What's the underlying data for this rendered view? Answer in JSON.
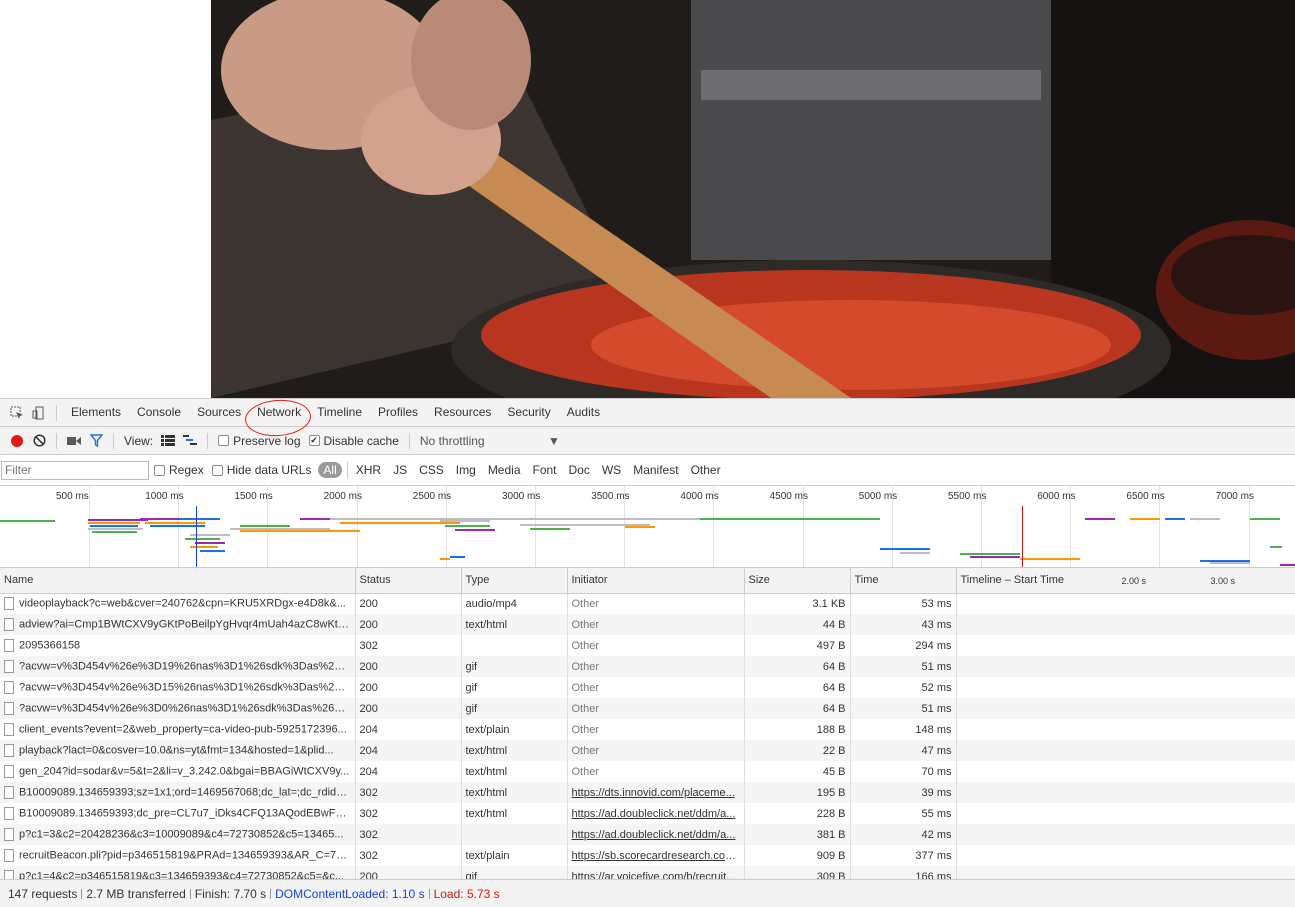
{
  "devtools_tabs": [
    "Elements",
    "Console",
    "Sources",
    "Network",
    "Timeline",
    "Profiles",
    "Resources",
    "Security",
    "Audits"
  ],
  "net_toolbar": {
    "view_label": "View:",
    "preserve_log": "Preserve log",
    "disable_cache": "Disable cache",
    "throttling": "No throttling"
  },
  "filter": {
    "placeholder": "Filter",
    "regex": "Regex",
    "hide_data_urls": "Hide data URLs",
    "types": [
      "All",
      "XHR",
      "JS",
      "CSS",
      "Img",
      "Media",
      "Font",
      "Doc",
      "WS",
      "Manifest",
      "Other"
    ]
  },
  "overview_ticks": [
    "500 ms",
    "1000 ms",
    "1500 ms",
    "2000 ms",
    "2500 ms",
    "3000 ms",
    "3500 ms",
    "4000 ms",
    "4500 ms",
    "5000 ms",
    "5500 ms",
    "6000 ms",
    "6500 ms",
    "7000 ms"
  ],
  "table": {
    "columns": [
      "Name",
      "Status",
      "Type",
      "Initiator",
      "Size",
      "Time",
      "Timeline – Start Time"
    ],
    "timeline_marks": [
      "2.00 s",
      "3.00 s"
    ],
    "rows": [
      {
        "name": "videoplayback?c=web&cver=240762&cpn=KRU5XRDgx-e4D8k&...",
        "status": "200",
        "type": "audio/mp4",
        "initiator": "Other",
        "size": "3.1 KB",
        "time": "53 ms"
      },
      {
        "name": "adview?ai=Cmp1BWtCXV9yGKtPoBeilpYgHvqr4mUah4azC8wKtAh...",
        "status": "200",
        "type": "text/html",
        "initiator": "Other",
        "size": "44 B",
        "time": "43 ms"
      },
      {
        "name": "2095366158",
        "status": "302",
        "type": "",
        "initiator": "Other",
        "size": "497 B",
        "time": "294 ms"
      },
      {
        "name": "?acvw=v%3D454v%26e%3D19%26nas%3D1%26sdk%3Das%26p%...",
        "status": "200",
        "type": "gif",
        "initiator": "Other",
        "size": "64 B",
        "time": "51 ms"
      },
      {
        "name": "?acvw=v%3D454v%26e%3D15%26nas%3D1%26sdk%3Das%26p%...",
        "status": "200",
        "type": "gif",
        "initiator": "Other",
        "size": "64 B",
        "time": "52 ms"
      },
      {
        "name": "?acvw=v%3D454v%26e%3D0%26nas%3D1%26sdk%3Das%26p%3...",
        "status": "200",
        "type": "gif",
        "initiator": "Other",
        "size": "64 B",
        "time": "51 ms"
      },
      {
        "name": "client_events?event=2&web_property=ca-video-pub-5925172396...",
        "status": "204",
        "type": "text/plain",
        "initiator": "Other",
        "size": "188 B",
        "time": "148 ms"
      },
      {
        "name": "playback?lact=0&cosver=10.0&ns=yt&fmt=134&hosted=1&plid...",
        "status": "204",
        "type": "text/html",
        "initiator": "Other",
        "size": "22 B",
        "time": "47 ms"
      },
      {
        "name": "gen_204?id=sodar&v=5&t=2&li=v_3.242.0&bgai=BBAGiWtCXV9y...",
        "status": "204",
        "type": "text/html",
        "initiator": "Other",
        "size": "45 B",
        "time": "70 ms"
      },
      {
        "name": "B10009089.134659393;sz=1x1;ord=1469567068;dc_lat=;dc_rdid=;...",
        "status": "302",
        "type": "text/html",
        "initiator": "https://dts.innovid.com/placeme...",
        "size": "195 B",
        "time": "39 ms"
      },
      {
        "name": "B10009089.134659393;dc_pre=CL7u7_iDks4CFQ13AQodEBwFzA;s...",
        "status": "302",
        "type": "text/html",
        "initiator": "https://ad.doubleclick.net/ddm/a...",
        "size": "228 B",
        "time": "55 ms"
      },
      {
        "name": "p?c1=3&c2=20428236&c3=10009089&c4=72730852&c5=13465...",
        "status": "302",
        "type": "",
        "initiator": "https://ad.doubleclick.net/ddm/a...",
        "size": "381 B",
        "time": "42 ms"
      },
      {
        "name": "recruitBeacon.pli?pid=p346515819&PRAd=134659393&AR_C=72...",
        "status": "302",
        "type": "text/plain",
        "initiator": "https://sb.scorecardresearch.com...",
        "size": "909 B",
        "time": "377 ms"
      },
      {
        "name": "p?c1=4&c2=p346515819&c3=134659393&c4=72730852&c5=&c...",
        "status": "200",
        "type": "gif",
        "initiator": "https://ar.voicefive.com/b/recruit...",
        "size": "309 B",
        "time": "166 ms"
      }
    ]
  },
  "status_bar": {
    "requests": "147 requests",
    "transferred": "2.7 MB transferred",
    "finish": "Finish: 7.70 s",
    "dom_loaded": "DOMContentLoaded: 1.10 s",
    "load": "Load: 5.73 s"
  },
  "colors": {
    "record": "#e4191a",
    "dom_loaded": "#1a40e0",
    "load": "#d01818",
    "annotation": "#e02020"
  }
}
